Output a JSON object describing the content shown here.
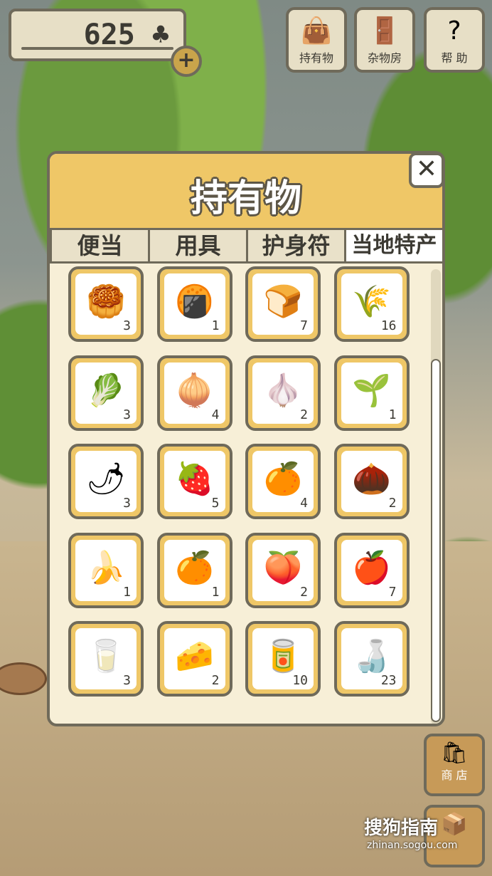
{
  "counter": {
    "value": "625",
    "currency_icon": "clover-icon",
    "plus_label": "+"
  },
  "top_buttons": [
    {
      "label": "持有物",
      "icon": "bag-icon"
    },
    {
      "label": "杂物房",
      "icon": "door-icon"
    },
    {
      "label": "帮 助",
      "icon": "question-icon"
    }
  ],
  "panel": {
    "title": "持有物",
    "close_label": "✕",
    "tabs": [
      {
        "label": "便当",
        "active": false
      },
      {
        "label": "用具",
        "active": false
      },
      {
        "label": "护身符",
        "active": false
      },
      {
        "label": "当地特产",
        "active": true
      }
    ]
  },
  "items": [
    {
      "icon": "mooncakes-icon",
      "qty": "3"
    },
    {
      "icon": "fried-snack-plate-icon",
      "qty": "1"
    },
    {
      "icon": "buns-icon",
      "qty": "7"
    },
    {
      "icon": "rice-sack-icon",
      "qty": "16"
    },
    {
      "icon": "cabbage-icon",
      "qty": "3"
    },
    {
      "icon": "onion-icon",
      "qty": "4"
    },
    {
      "icon": "garlic-icon",
      "qty": "2"
    },
    {
      "icon": "green-onion-icon",
      "qty": "1"
    },
    {
      "icon": "chili-peppers-icon",
      "qty": "3"
    },
    {
      "icon": "strawberry-icon",
      "qty": "5"
    },
    {
      "icon": "persimmon-icon",
      "qty": "4"
    },
    {
      "icon": "chestnuts-icon",
      "qty": "2"
    },
    {
      "icon": "banana-icon",
      "qty": "1"
    },
    {
      "icon": "orange-icon",
      "qty": "1"
    },
    {
      "icon": "peach-icon",
      "qty": "2"
    },
    {
      "icon": "apple-icon",
      "qty": "7"
    },
    {
      "icon": "milk-jug-icon",
      "qty": "3"
    },
    {
      "icon": "cheese-icon",
      "qty": "2"
    },
    {
      "icon": "tea-can-icon",
      "qty": "10"
    },
    {
      "icon": "glass-bottle-icon",
      "qty": "23"
    }
  ],
  "side_buttons": [
    {
      "label": "商 店",
      "icon": "shop-bags-icon"
    },
    {
      "label": "",
      "icon": "crate-icon"
    }
  ],
  "watermark": {
    "brand": "搜狗指南",
    "url": "zhinan.sogou.com"
  }
}
